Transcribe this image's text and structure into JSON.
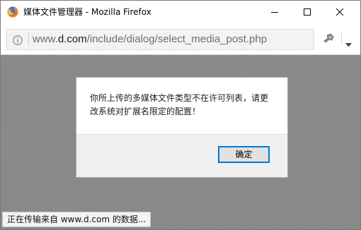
{
  "window": {
    "title": "媒体文件管理器 - Mozilla Firefox",
    "controls": {
      "minimize_icon": "minimize-icon",
      "maximize_icon": "maximize-icon",
      "close_icon": "close-icon"
    }
  },
  "address_bar": {
    "url_prefix": "www.",
    "url_host": "d.com",
    "url_path": "/include/dialog/select_media_post.php",
    "info_icon": "info-icon",
    "pin_icon": "pin-icon",
    "menu_icon": "chevron-down-icon"
  },
  "dialog": {
    "message": "你所上传的多媒体文件类型不在许可列表，请更改系统对扩展名限定的配置！",
    "ok_label": "确定"
  },
  "status_bar": {
    "text": "正在传输来自 www.d.com 的数据..."
  },
  "colors": {
    "accent": "#0078d7",
    "overlay": "#8a8a8a"
  }
}
